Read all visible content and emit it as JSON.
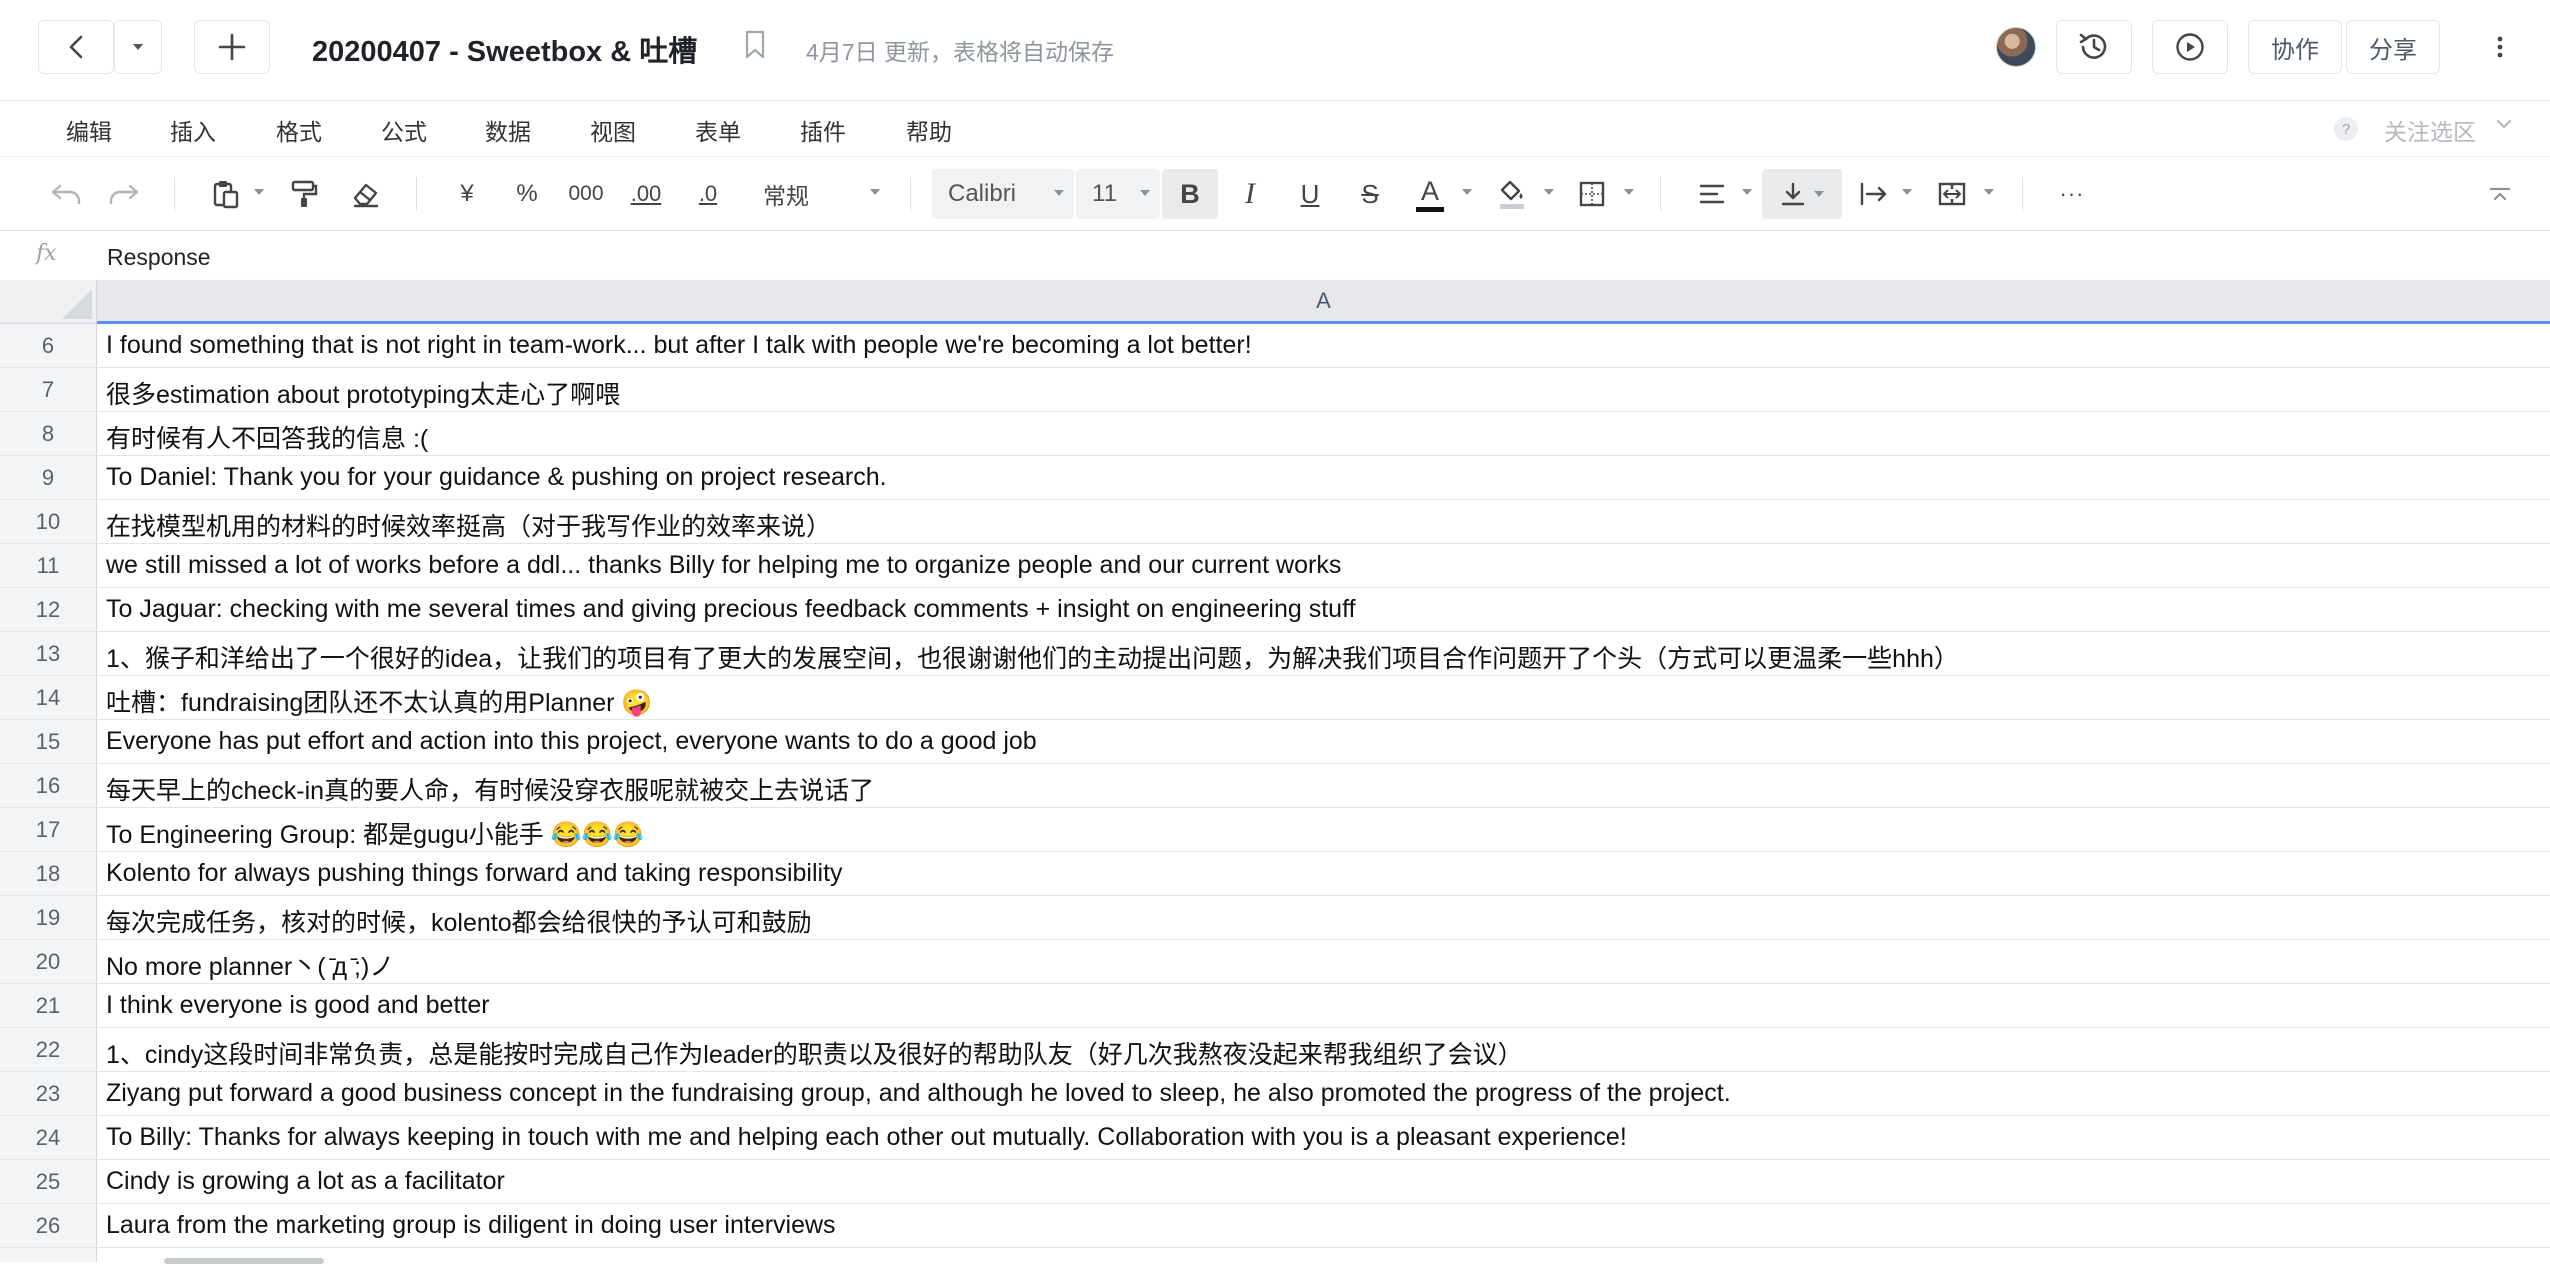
{
  "app": {
    "title": "20200407 - Sweetbox & 吐槽",
    "save_status": "4月7日 更新，表格将自动保存",
    "buttons": {
      "collaborate": "协作",
      "share": "分享"
    }
  },
  "menu": {
    "items": [
      "编辑",
      "插入",
      "格式",
      "公式",
      "数据",
      "视图",
      "表单",
      "插件",
      "帮助"
    ],
    "help_mark": "?",
    "focus_area": "关注选区"
  },
  "toolbar": {
    "currency": "¥",
    "percent": "%",
    "thousands": "000",
    "increase_decimal": ".00",
    "decrease_decimal": ".0",
    "number_format": "常规",
    "font_family": "Calibri",
    "font_size": "11",
    "bold": "B",
    "italic": "I",
    "underline": "U",
    "strikethrough": "S",
    "font_color_letter": "A",
    "font_color": "#111111",
    "more": "···"
  },
  "formula_bar": {
    "fx": "fx",
    "value": "Response"
  },
  "grid": {
    "column_header": "A",
    "rows": [
      {
        "num": "6",
        "text": "I found something that is not right in  team-work... but after I talk with people we're becoming a lot better!"
      },
      {
        "num": "7",
        "text": "很多estimation about prototyping太走心了啊喂"
      },
      {
        "num": "8",
        "text": "有时候有人不回答我的信息 :("
      },
      {
        "num": "9",
        "text": "To Daniel: Thank you for your guidance  & pushing on project research."
      },
      {
        "num": "10",
        "text": "在找模型机用的材料的时候效率挺高（对于我写作业的效率来说）"
      },
      {
        "num": "11",
        "text": "we still missed a lot of works before a  ddl... thanks Billy for helping me to organize people and our current works"
      },
      {
        "num": "12",
        "text": "To Jaguar: checking with me several times  and giving precious feedback comments + insight on engineering stuff"
      },
      {
        "num": "13",
        "text": "1、猴子和洋给出了一个很好的idea，让我们的项目有了更大的发展空间，也很谢谢他们的主动提出问题，为解决我们项目合作问题开了个头（方式可以更温柔一些hhh）"
      },
      {
        "num": "14",
        "text": "吐槽：fundraising团队还不太认真的用Planner 🤪"
      },
      {
        "num": "15",
        "text": "Everyone has put effort and action into  this project, everyone wants to do a good job"
      },
      {
        "num": "16",
        "text": "每天早上的check-in真的要人命，有时候没穿衣服呢就被交上去说话了"
      },
      {
        "num": "17",
        "text": "To Engineering Group: 都是gugu小能手  😂😂😂"
      },
      {
        "num": "18",
        "text": "Kolento for always pushing things forward  and taking responsibility"
      },
      {
        "num": "19",
        "text": "每次完成任务，核对的时候，kolento都会给很快的予认可和鼓励"
      },
      {
        "num": "20",
        "text": "No more planner丶(  ̄д ̄;)ノ"
      },
      {
        "num": "21",
        "text": "I think everyone is good and better"
      },
      {
        "num": "22",
        "text": "1、cindy这段时间非常负责，总是能按时完成自己作为leader的职责以及很好的帮助队友（好几次我熬夜没起来帮我组织了会议）"
      },
      {
        "num": "23",
        "text": "Ziyang put forward a good business  concept in the fundraising group, and although he loved to sleep, he also  promoted the progress of the project."
      },
      {
        "num": "24",
        "text": "To Billy: Thanks for always keeping in  touch with me and helping each other out mutually. Collaboration with you is  a pleasant experience!"
      },
      {
        "num": "25",
        "text": "Cindy is growing a lot as a facilitator"
      },
      {
        "num": "26",
        "text": "Laura from the marketing group is  diligent in doing user interviews"
      }
    ]
  },
  "colors": {
    "selection_accent": "#5b8ff0",
    "header_bg": "#e5e7ea"
  }
}
